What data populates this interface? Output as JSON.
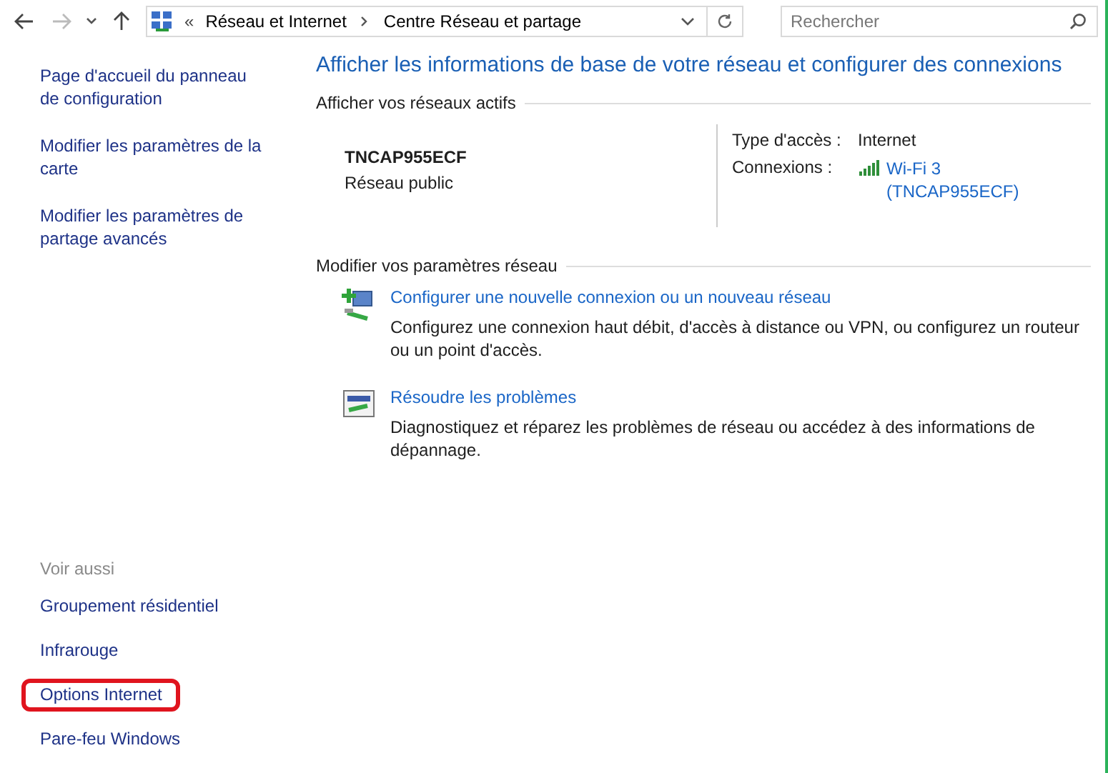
{
  "breadcrumb": {
    "separator": "«",
    "items": [
      "Réseau et Internet",
      "Centre Réseau et partage"
    ]
  },
  "search": {
    "placeholder": "Rechercher"
  },
  "sidebar": {
    "links": [
      "Page d'accueil du panneau de configuration",
      "Modifier les paramètres de la carte",
      "Modifier les paramètres de partage avancés"
    ],
    "see_also": {
      "heading": "Voir aussi",
      "items": [
        {
          "label": "Groupement résidentiel",
          "circled": false
        },
        {
          "label": "Infrarouge",
          "circled": false
        },
        {
          "label": "Options Internet",
          "circled": true
        },
        {
          "label": "Pare-feu Windows",
          "circled": false
        }
      ]
    }
  },
  "title": "Afficher les informations de base de votre réseau et configurer des connexions",
  "active_networks": {
    "heading": "Afficher vos réseaux actifs",
    "name": "TNCAP955ECF",
    "category": "Réseau public",
    "properties": [
      {
        "label": "Type d'accès :",
        "value": "Internet",
        "kind": "text"
      },
      {
        "label": "Connexions :",
        "value": "Wi-Fi 3\n(TNCAP955ECF)",
        "kind": "link"
      }
    ]
  },
  "settings": {
    "heading": "Modifier vos paramètres réseau",
    "tasks": [
      {
        "kind": "new-connection",
        "link": "Configurer une nouvelle connexion ou un nouveau réseau",
        "description": "Configurez une connexion haut débit, d'accès à distance ou VPN, ou configurez un routeur ou un point d'accès."
      },
      {
        "kind": "troubleshoot",
        "link": "Résoudre les problèmes",
        "description": "Diagnostiquez et réparez les problèmes de réseau ou accédez à des informations de dépannage."
      }
    ]
  }
}
